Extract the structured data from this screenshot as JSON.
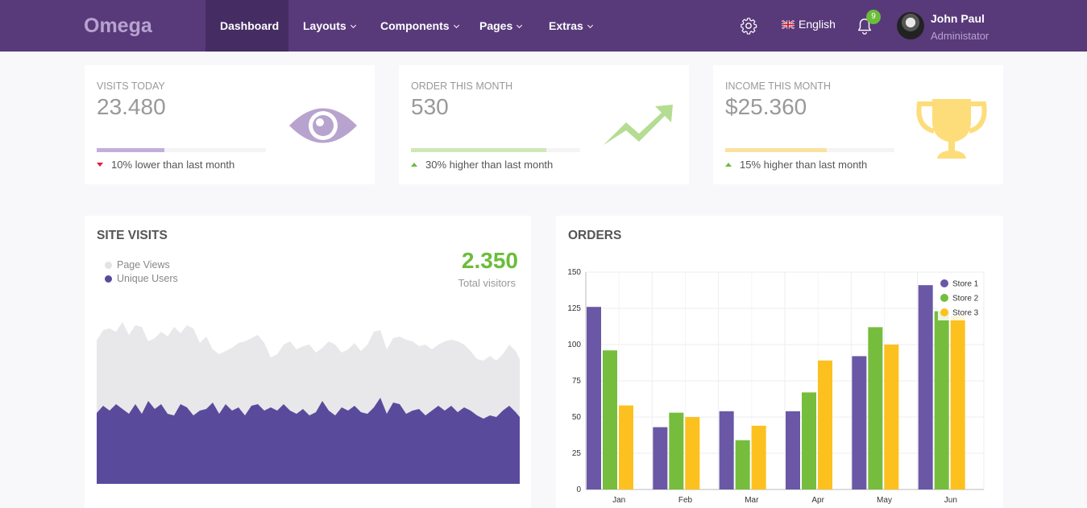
{
  "brand": "Omega",
  "nav": [
    {
      "label": "Dashboard",
      "active": true
    },
    {
      "label": "Layouts"
    },
    {
      "label": "Components"
    },
    {
      "label": "Pages"
    },
    {
      "label": "Extras"
    }
  ],
  "header": {
    "language": "English",
    "notification_count": "9",
    "user_name": "John Paul",
    "user_role": "Administator"
  },
  "stats": [
    {
      "label": "Visits Today",
      "value": "23.480",
      "progress": 0.4,
      "color": "#c3aedb",
      "trend": "down",
      "trend_text": "10% lower than last month",
      "icon": "eye-icon"
    },
    {
      "label": "Order This Month",
      "value": "530",
      "progress": 0.8,
      "color": "#cfe8b6",
      "trend": "up",
      "trend_text": "30% higher than last month",
      "icon": "trend-up-icon"
    },
    {
      "label": "Income This Month",
      "value": "$25.360",
      "progress": 0.6,
      "color": "#fbe19e",
      "trend": "up",
      "trend_text": "15% higher than last month",
      "icon": "trophy-icon"
    }
  ],
  "site_visits": {
    "title": "SITE VISITS",
    "legend": [
      "Page Views",
      "Unique Users"
    ],
    "total": "2.350",
    "total_label": "Total visitors",
    "colors": {
      "page_views": "#e8e8ea",
      "unique_users": "#5a4a9c"
    }
  },
  "orders": {
    "title": "ORDERS"
  },
  "chart_data": {
    "type": "bar",
    "categories": [
      "Jan",
      "Feb",
      "Mar",
      "Apr",
      "May",
      "Jun"
    ],
    "ylim": [
      0,
      150
    ],
    "yticks": [
      0,
      25,
      50,
      75,
      100,
      125,
      150
    ],
    "legend_position": "top-right",
    "grid": true,
    "series": [
      {
        "name": "Store 1",
        "color": "#6a57a6",
        "values": [
          126,
          43,
          54,
          54,
          92,
          141
        ]
      },
      {
        "name": "Store 2",
        "color": "#76bd3d",
        "values": [
          96,
          53,
          34,
          67,
          112,
          123
        ]
      },
      {
        "name": "Store 3",
        "color": "#fcc11e",
        "values": [
          58,
          50,
          44,
          89,
          100,
          120
        ]
      }
    ]
  }
}
